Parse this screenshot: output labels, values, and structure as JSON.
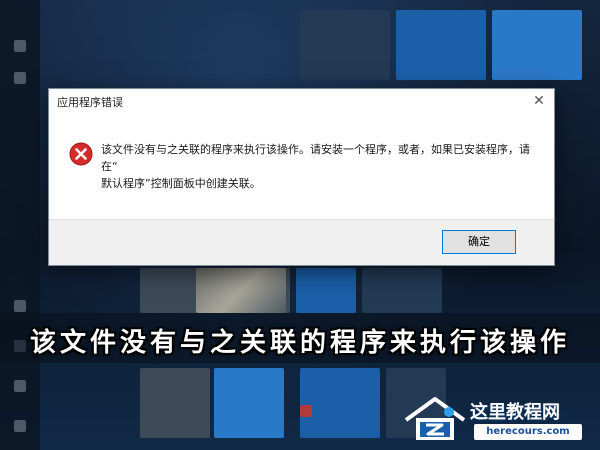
{
  "dialog": {
    "title": "应用程序错误",
    "close_glyph": "✕",
    "icon": "error-icon",
    "message_line1": "该文件没有与之关联的程序来执行该操作。请安装一个程序，或者，如果已安装程序，请在“",
    "message_line2": "默认程序”控制面板中创建关联。",
    "ok_label": "确定"
  },
  "caption": {
    "text": "该文件没有与之关联的程序来执行该操作"
  },
  "watermark": {
    "name": "这里教程网",
    "domain": "herecours.com"
  },
  "colors": {
    "error_red": "#d42b2b",
    "button_border": "#0078d7",
    "footer_bg": "#f0f0f0"
  }
}
